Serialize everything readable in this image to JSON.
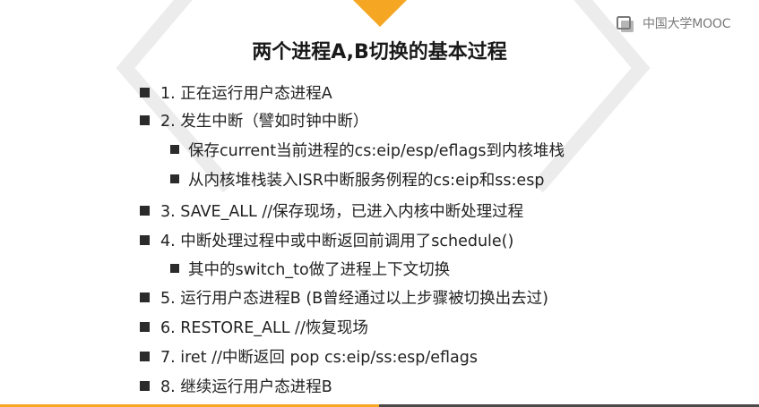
{
  "brand": {
    "logo_text": "中国大学MOOC",
    "icon": "mooc-logo-icon"
  },
  "colors": {
    "accent": "#f5a623",
    "frame": "#e6e6e6",
    "text": "#222222",
    "bar_dark": "#4a4a4a"
  },
  "slide": {
    "title": "两个进程A,B切换的基本过程",
    "bullets": [
      {
        "text": "1. 正在运行用户态进程A",
        "level": 1
      },
      {
        "text": "2. 发生中断（譬如时钟中断）",
        "level": 1
      },
      {
        "text": "保存current当前进程的cs:eip/esp/eflags到内核堆栈",
        "level": 2
      },
      {
        "text": "从内核堆栈装入ISR中断服务例程的cs:eip和ss:esp",
        "level": 2
      },
      {
        "text": "3. SAVE_ALL  //保存现场，已进入内核中断处理过程",
        "level": 1
      },
      {
        "text": "4. 中断处理过程中或中断返回前调用了schedule()",
        "level": 1
      },
      {
        "text": "其中的switch_to做了进程上下文切换",
        "level": 2
      },
      {
        "text": "5. 运行用户态进程B (B曾经通过以上步骤被切换出去过)",
        "level": 1
      },
      {
        "text": "6. RESTORE_ALL //恢复现场",
        "level": 1
      },
      {
        "text": "7. iret //中断返回 pop cs:eip/ss:esp/eflags",
        "level": 1
      },
      {
        "text": "8. 继续运行用户态进程B",
        "level": 1
      }
    ]
  }
}
